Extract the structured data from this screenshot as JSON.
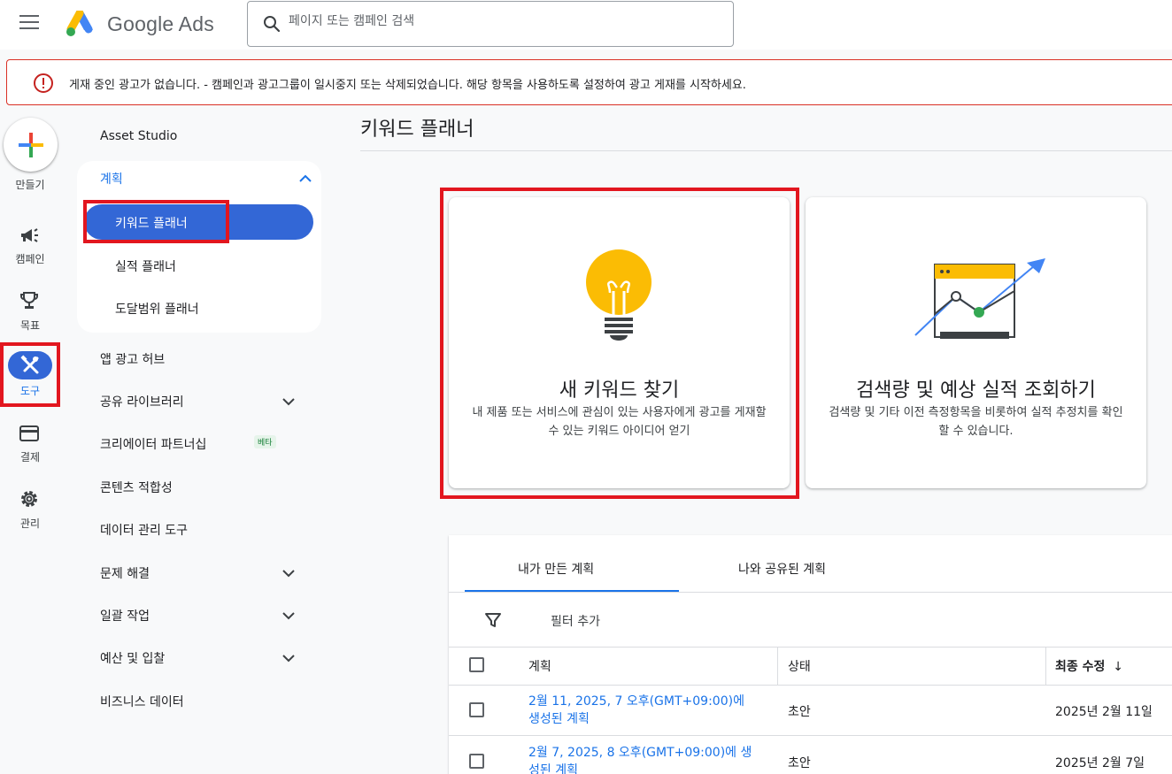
{
  "header": {
    "brand": "Google Ads",
    "search_placeholder": "페이지 또는 캠페인 검색"
  },
  "alert": {
    "message": "게재 중인 광고가 없습니다. - 캠페인과 광고그룹이 일시중지 또는 삭제되었습니다. 해당 항목을 사용하도록 설정하여 광고 게재를 시작하세요."
  },
  "rail": {
    "create": "만들기",
    "campaigns": "캠페인",
    "goals": "목표",
    "tools": "도구",
    "billing": "결제",
    "admin": "관리"
  },
  "nav": {
    "asset_studio": "Asset Studio",
    "planning": "계획",
    "keyword_planner": "키워드 플래너",
    "performance_planner": "실적 플래너",
    "reach_planner": "도달범위 플래너",
    "app_ads_hub": "앱 광고 허브",
    "shared_library": "공유 라이브러리",
    "creator_partnerships": "크리에이터 파트너십",
    "beta_badge": "베타",
    "content_suitability": "콘텐츠 적합성",
    "data_manager": "데이터 관리 도구",
    "troubleshooting": "문제 해결",
    "bulk_actions": "일괄 작업",
    "budgets_bidding": "예산 및 입찰",
    "business_data": "비즈니스 데이터"
  },
  "main": {
    "title": "키워드 플래너",
    "card_discover": {
      "title": "새 키워드 찾기",
      "desc": "내 제품 또는 서비스에 관심이 있는 사용자에게 광고를 게재할 수 있는 키워드 아이디어 얻기"
    },
    "card_forecast": {
      "title": "검색량 및 예상 실적 조회하기",
      "desc": "검색량 및 기타 이전 측정항목을 비롯하여 실적 추정치를 확인할 수 있습니다."
    }
  },
  "plans": {
    "tab_mine": "내가 만든 계획",
    "tab_shared": "나와 공유된 계획",
    "filter": "필터 추가",
    "col_plan": "계획",
    "col_status": "상태",
    "col_modified": "최종 수정",
    "rows": [
      {
        "plan": "2월 11, 2025, 7 오후(GMT+09:00)에 생성된 계획",
        "status": "초안",
        "modified": "2025년 2월 11일"
      },
      {
        "plan": "2월 7, 2025, 8 오후(GMT+09:00)에 생성된 계획",
        "status": "초안",
        "modified": "2025년 2월 7일"
      }
    ]
  },
  "colors": {
    "accent": "#3367d6",
    "link": "#1a73e8",
    "highlight": "#e2161f",
    "alert_border": "#d93025"
  }
}
